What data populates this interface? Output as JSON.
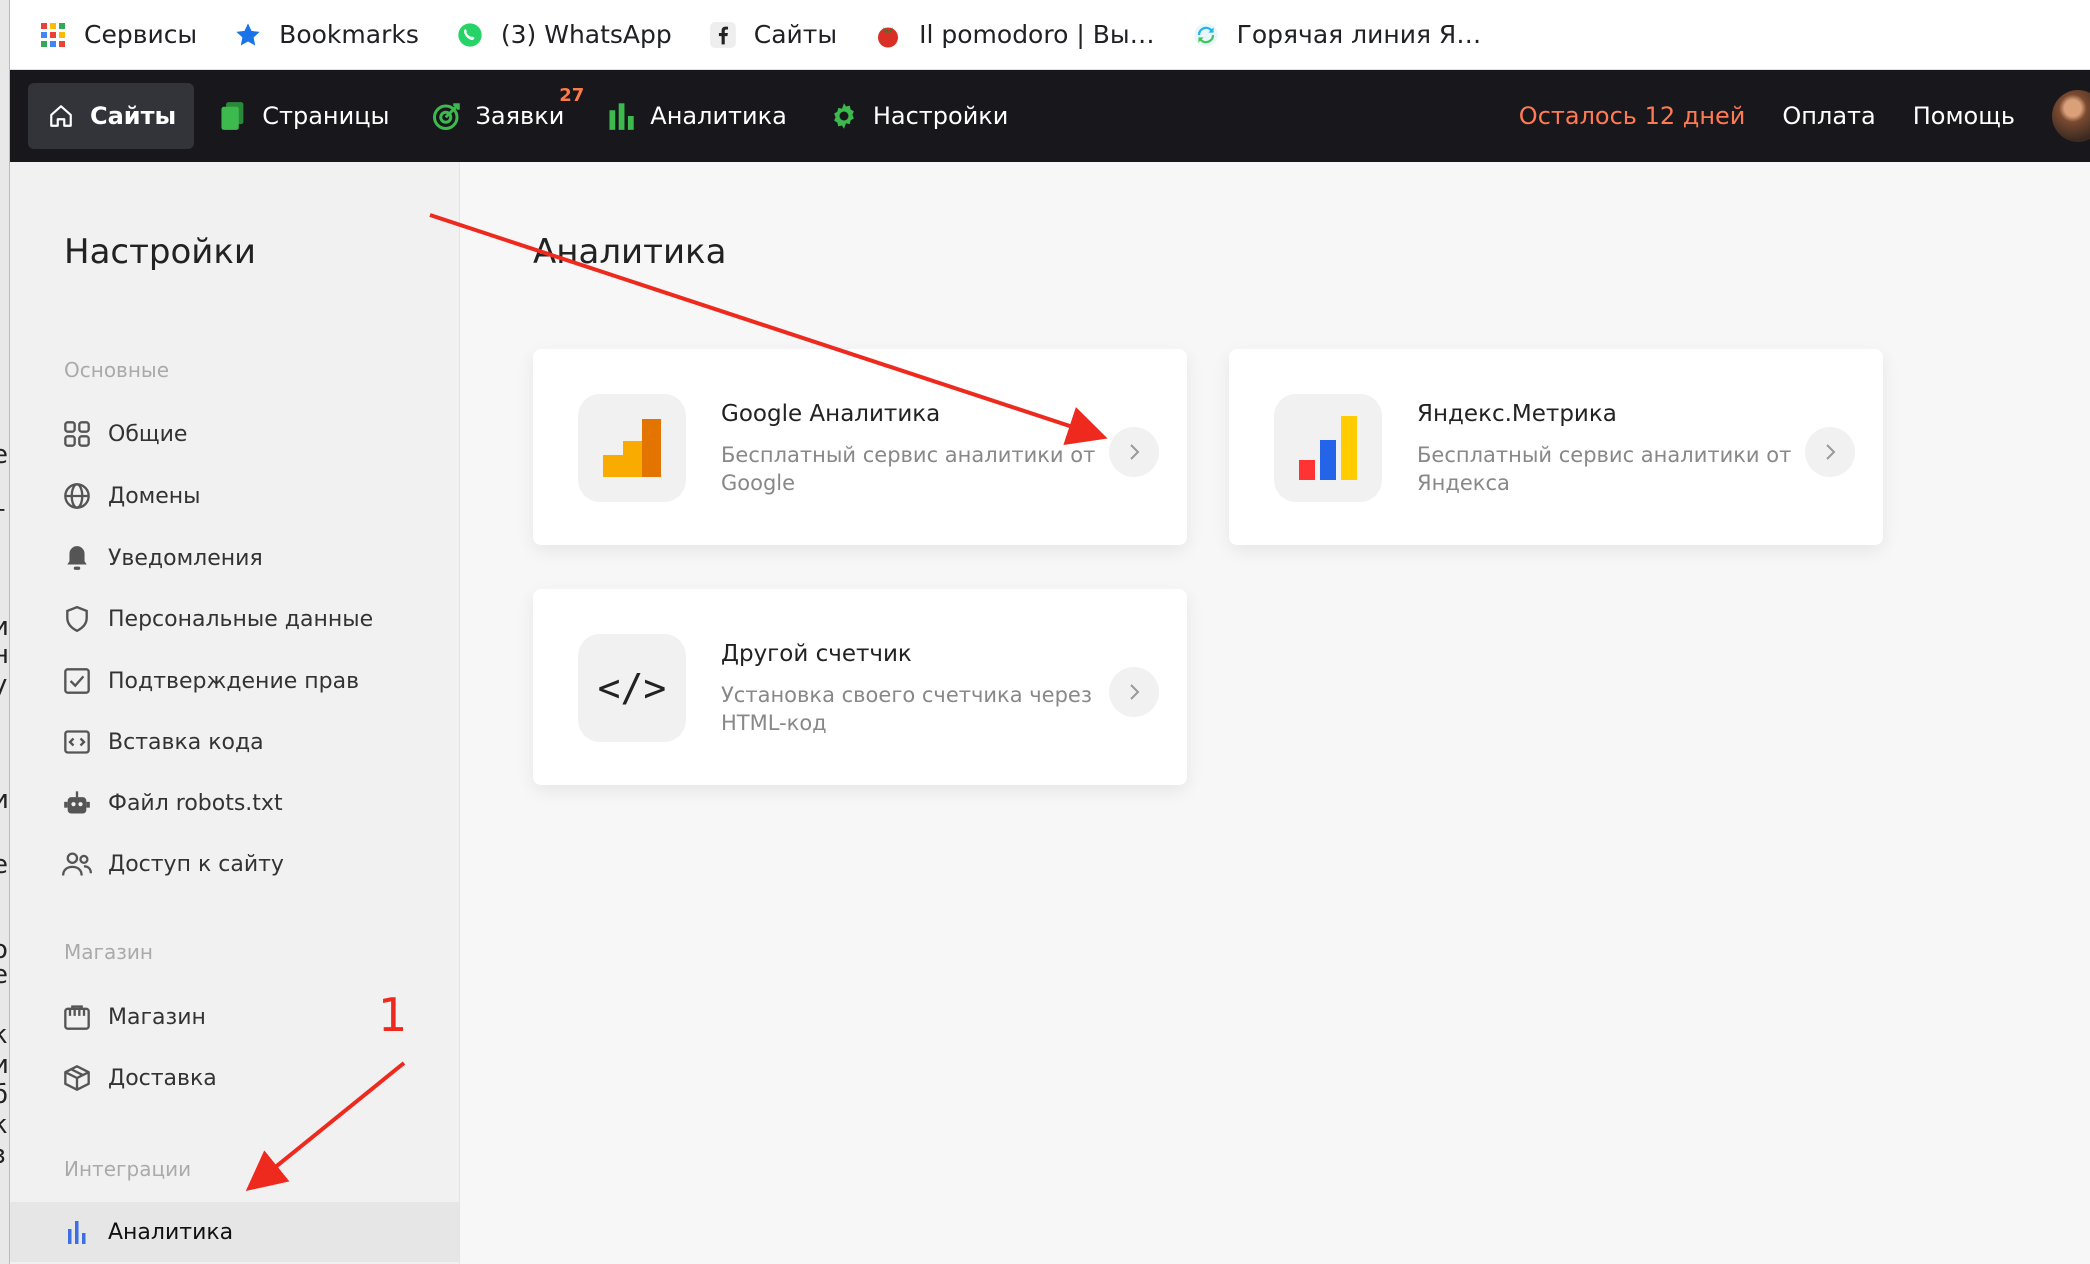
{
  "bookmarks": [
    {
      "label": "Сервисы",
      "icon": "apps-grid-icon"
    },
    {
      "label": "Bookmarks",
      "icon": "star-icon"
    },
    {
      "label": "(3) WhatsApp",
      "icon": "whatsapp-icon"
    },
    {
      "label": "Сайты",
      "icon": "facebook-icon"
    },
    {
      "label": "Il pomodoro | Вы…",
      "icon": "tomato-icon"
    },
    {
      "label": "Горячая линия Я…",
      "icon": "sync-icon"
    }
  ],
  "nav": {
    "items": [
      {
        "label": "Сайты",
        "icon": "home-icon"
      },
      {
        "label": "Страницы",
        "icon": "pages-icon"
      },
      {
        "label": "Заявки",
        "icon": "target-icon",
        "badge": "27"
      },
      {
        "label": "Аналитика",
        "icon": "bar-chart-icon"
      },
      {
        "label": "Настройки",
        "icon": "gear-icon"
      }
    ],
    "trial": "Осталось 12 дней",
    "payment": "Оплата",
    "help": "Помощь"
  },
  "sidebar": {
    "title": "Настройки",
    "sections": [
      {
        "title": "Основные",
        "items": [
          "Общие",
          "Домены",
          "Уведомления",
          "Персональные данные",
          "Подтверждение прав",
          "Вставка кода",
          "Файл robots.txt",
          "Доступ к сайту"
        ]
      },
      {
        "title": "Магазин",
        "items": [
          "Магазин",
          "Доставка"
        ]
      },
      {
        "title": "Интеграции",
        "items": [
          "Аналитика"
        ]
      }
    ]
  },
  "main": {
    "title": "Аналитика",
    "cards": [
      {
        "name": "Google Аналитика",
        "description": "Бесплатный сервис аналитики от Google"
      },
      {
        "name": "Яндекс.Метрика",
        "description": "Бесплатный сервис аналитики от Яндекса"
      },
      {
        "name": "Другой счетчик",
        "description": "Установка своего счетчика через HTML-код",
        "code_symbol": "</>"
      }
    ]
  },
  "annotation": {
    "step": "1"
  },
  "colors": {
    "nav_bg": "#17171c",
    "warn": "#ff7a52",
    "arrow": "#ee2a1f",
    "nav_icon": "#3dba4e"
  }
}
